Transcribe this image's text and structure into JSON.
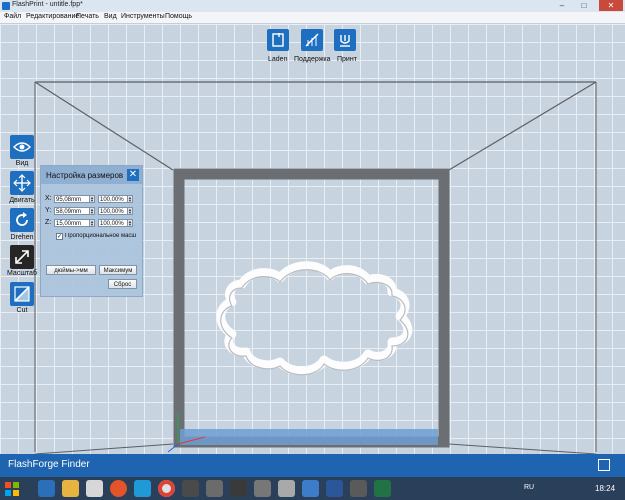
{
  "window": {
    "title": "FlashPrint - untitle.fpp*",
    "controls": [
      "–",
      "□",
      "✕"
    ]
  },
  "menu": [
    "Файл",
    "Редактирование",
    "Печать",
    "Вид",
    "Инструменты",
    "Помощь"
  ],
  "toolbar": {
    "load_label": "Laden",
    "support_label": "Поддержка",
    "print_label": "Принт"
  },
  "sidebar": {
    "items": [
      {
        "label": "Вид",
        "icon": "eye-icon"
      },
      {
        "label": "Двигать",
        "icon": "move-icon"
      },
      {
        "label": "Drehen",
        "icon": "rotate-icon"
      },
      {
        "label": "Масштаб",
        "icon": "scale-icon"
      },
      {
        "label": "Cut",
        "icon": "cut-icon"
      }
    ]
  },
  "scale_panel": {
    "title": "Настройка размеров",
    "close": "✕",
    "rows": [
      {
        "axis": "X:",
        "size": "95,08mm",
        "percent": "100,00%"
      },
      {
        "axis": "Y:",
        "size": "58,09mm",
        "percent": "100,00%"
      },
      {
        "axis": "Z:",
        "size": "15,00mm",
        "percent": "100,00%"
      }
    ],
    "uniform_checked": "✓",
    "uniform_label": "Пропорциональное масш",
    "inch_mm_button": "дюймы->мм",
    "max_button": "Максимум",
    "reset_button": "Сброс"
  },
  "status_bar": {
    "app_name": "FlashForge Finder"
  },
  "taskbar": {
    "language": "RU",
    "clock": "18:24"
  },
  "colors": {
    "accent": "#1e6fc0",
    "status_bar": "#1f64b0",
    "taskbar": "#2a3f5a",
    "build_frame": "#6b6f73"
  }
}
